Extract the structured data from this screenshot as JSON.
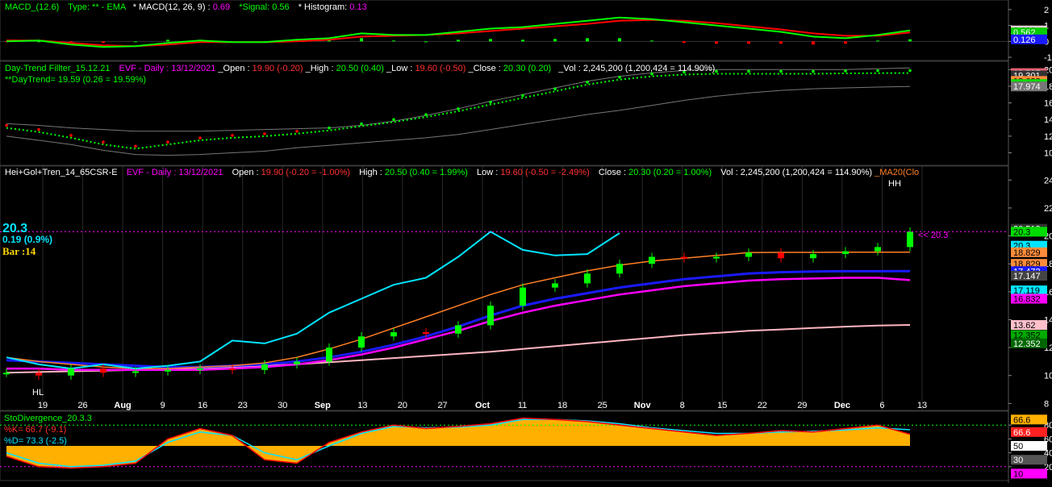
{
  "colors": {
    "bg": "#000000",
    "panel_sep": "#3a3a3a",
    "grid": "#2a2a2a",
    "axis_text": "#ffffff",
    "green": "#00ff00",
    "red": "#ff0000",
    "cyan": "#00e5ff",
    "blue": "#1a1aff",
    "magenta": "#ff00ff",
    "orange": "#ff7f27",
    "pink": "#ffb6c1",
    "grey": "#9a9a9a",
    "yellow": "#ffff00",
    "gold": "#ffd700"
  },
  "macd_panel": {
    "title": "MACD_(12.6)",
    "type_label": "Type: ** - EMA",
    "macd_label": "* MACD(12, 26, 9) : ",
    "macd_value": "0.69",
    "signal_label": "*Signal: ",
    "signal_value": "0.56",
    "hist_label": "* Histogram: ",
    "hist_value": "0.13",
    "axis_ticks": [
      {
        "label": "2",
        "v": 2
      },
      {
        "label": "1",
        "v": 1
      },
      {
        "label": "0",
        "v": 0
      },
      {
        "label": "-1",
        "v": -1
      }
    ],
    "badges": [
      {
        "label": "0.688",
        "v": 0.688,
        "fill": "#ffd0d8",
        "text": "#000000"
      },
      {
        "label": "0.562",
        "v": 0.562,
        "fill": "#00cc00",
        "text": "#ffffff"
      },
      {
        "label": "0.126",
        "v": 0.126,
        "fill": "#1a1aff",
        "text": "#ffffff"
      }
    ]
  },
  "daytrend_panel": {
    "title": "Day-Trend Fillter_15.12.21",
    "evf": "EVF - Daily :  13/12/2021",
    "open_label": "_Open : ",
    "open_value": "19.90 (-0.20)",
    "high_label": "_High : ",
    "high_value": "20.50 (0.40)",
    "low_label": "_Low : ",
    "low_value": "19.60 (-0.50)",
    "close_label": "_Close : ",
    "close_value": "20.30  (0.20)",
    "vol_label": "_Vol : ",
    "vol_value": "2,245,200 (1,200,424 = 114.90%)",
    "line2": "**DayTrend= 19.59 (0.26 = 19.59%)",
    "axis_ticks": [
      {
        "label": "20",
        "v": 20
      },
      {
        "label": "18",
        "v": 18
      },
      {
        "label": "16",
        "v": 16
      },
      {
        "label": "14",
        "v": 14
      },
      {
        "label": "12",
        "v": 12
      },
      {
        "label": "10",
        "v": 10
      }
    ],
    "badges": [
      {
        "label": "19.587",
        "v": 19.587,
        "fill": "#e06070",
        "text": "#ffffff"
      },
      {
        "label": "19.301",
        "v": 19.301,
        "fill": "#333333",
        "text": "#ffffff"
      },
      {
        "label": "18.638",
        "v": 18.638,
        "fill": "#ff8c3a",
        "text": "#000000"
      },
      {
        "label": "18.262",
        "v": 18.262,
        "fill": "#00dd00",
        "text": "#000000"
      },
      {
        "label": "17.974",
        "v": 17.974,
        "fill": "#777777",
        "text": "#ffffff"
      }
    ]
  },
  "price_panel": {
    "title": "Hei+Gol+Tren_14_65CSR-E",
    "evf": "EVF - Daily :  13/12/2021",
    "open_label": "Open : ",
    "open_value": "19.90 (-0.20 = -1.00%)",
    "high_label": "High : ",
    "high_value": "20.50 (0.40 = 1.99%)",
    "low_label": "Low : ",
    "low_value": "19.60 (-0.50 = -2.49%)",
    "close_label": "Close : ",
    "close_value": "20.30  (0.20 = 1.00%)",
    "vol_label": "Vol : ",
    "vol_value": "2,245,200 (1,200,424 = 114.90%)",
    "ma_label": "_MA20(Clo",
    "big_price": "20.3",
    "change": "0.19 (0.9%)",
    "bar": "Bar :14",
    "last_marker": "<< 20.3",
    "hh": "HH",
    "hl": "HL",
    "axis_ticks": [
      {
        "label": "24",
        "v": 24
      },
      {
        "label": "22",
        "v": 22
      },
      {
        "label": "20",
        "v": 20
      },
      {
        "label": "18",
        "v": 18
      },
      {
        "label": "16",
        "v": 16
      },
      {
        "label": "14",
        "v": 14
      },
      {
        "label": "12",
        "v": 12
      },
      {
        "label": "10",
        "v": 10
      },
      {
        "label": "8",
        "v": 8
      }
    ],
    "badges": [
      {
        "label": "20.512",
        "v": 20.512,
        "fill": "#333333",
        "text": "#ffffff"
      },
      {
        "label": "20.3",
        "v": 20.3,
        "fill": "#00dd00",
        "text": "#000000"
      },
      {
        "label": "20.3",
        "v": 19.3,
        "fill": "#00e5ff",
        "text": "#000000"
      },
      {
        "label": "18.829",
        "v": 18.829,
        "fill": "#ff8c3a",
        "text": "#000000"
      },
      {
        "label": "18.829",
        "v": 18.0,
        "fill": "#ff8c3a",
        "text": "#000000"
      },
      {
        "label": "17.472",
        "v": 17.472,
        "fill": "#1a1aff",
        "text": "#ffffff"
      },
      {
        "label": "17.147",
        "v": 17.147,
        "fill": "#444444",
        "text": "#ffffff"
      },
      {
        "label": "17.119",
        "v": 16.1,
        "fill": "#00e5ff",
        "text": "#000000"
      },
      {
        "label": "16.832",
        "v": 15.5,
        "fill": "#ff00ff",
        "text": "#000000"
      },
      {
        "label": "13.62",
        "v": 13.62,
        "fill": "#ffc0cb",
        "text": "#000000"
      },
      {
        "label": "12.352",
        "v": 12.9,
        "fill": "#00aa00",
        "text": "#000000"
      },
      {
        "label": "12.352",
        "v": 12.3,
        "fill": "#006600",
        "text": "#ffffff"
      }
    ]
  },
  "x_axis": [
    {
      "label": "19",
      "bold": false
    },
    {
      "label": "26",
      "bold": false
    },
    {
      "label": "Aug",
      "bold": true
    },
    {
      "label": "9",
      "bold": false
    },
    {
      "label": "16",
      "bold": false
    },
    {
      "label": "23",
      "bold": false
    },
    {
      "label": "30",
      "bold": false
    },
    {
      "label": "Sep",
      "bold": true
    },
    {
      "label": "13",
      "bold": false
    },
    {
      "label": "20",
      "bold": false
    },
    {
      "label": "27",
      "bold": false
    },
    {
      "label": "Oct",
      "bold": true
    },
    {
      "label": "11",
      "bold": false
    },
    {
      "label": "18",
      "bold": false
    },
    {
      "label": "25",
      "bold": false
    },
    {
      "label": "Nov",
      "bold": true
    },
    {
      "label": "8",
      "bold": false
    },
    {
      "label": "15",
      "bold": false
    },
    {
      "label": "22",
      "bold": false
    },
    {
      "label": "29",
      "bold": false
    },
    {
      "label": "Dec",
      "bold": true
    },
    {
      "label": "6",
      "bold": false
    },
    {
      "label": "13",
      "bold": false
    }
  ],
  "sto_panel": {
    "title": "StoDivergence_20.3.3",
    "k_label": "%K= 66.7 (-9.1)",
    "d_label": "%D= 73.3 (-2.5)",
    "axis_ticks": [
      {
        "label": "80",
        "v": 80
      },
      {
        "label": "60",
        "v": 60
      },
      {
        "label": "40",
        "v": 40
      },
      {
        "label": "20",
        "v": 20
      }
    ],
    "badges": [
      {
        "label": "66.6",
        "v": 88,
        "fill": "#ffb000",
        "text": "#000000"
      },
      {
        "label": "66.6",
        "v": 70,
        "fill": "#ff2020",
        "text": "#ffffff"
      },
      {
        "label": "50",
        "v": 50,
        "fill": "#ffffff",
        "text": "#000000"
      },
      {
        "label": "30",
        "v": 30,
        "fill": "#555555",
        "text": "#ffffff"
      },
      {
        "label": "10",
        "v": 10,
        "fill": "#ff00ff",
        "text": "#000000"
      }
    ]
  },
  "chart_data": [
    {
      "type": "line",
      "title": "MACD_(12.6)",
      "ylim": [
        -1.2,
        2.6
      ],
      "dates": [
        "2021-07-19",
        "2021-12-13"
      ],
      "series": [
        {
          "name": "MACD",
          "values": [
            0.0,
            0.05,
            -0.2,
            -0.35,
            -0.3,
            -0.1,
            0.05,
            -0.05,
            -0.05,
            0.1,
            0.2,
            0.5,
            0.4,
            0.4,
            0.6,
            0.8,
            0.9,
            1.1,
            1.3,
            1.5,
            1.4,
            1.2,
            1.0,
            0.8,
            0.6,
            0.3,
            0.2,
            0.4,
            0.69
          ]
        },
        {
          "name": "Signal",
          "values": [
            0.05,
            0.05,
            -0.1,
            -0.25,
            -0.3,
            -0.2,
            -0.05,
            -0.05,
            -0.05,
            0.0,
            0.1,
            0.3,
            0.35,
            0.4,
            0.5,
            0.65,
            0.8,
            0.95,
            1.1,
            1.3,
            1.35,
            1.3,
            1.15,
            0.95,
            0.75,
            0.5,
            0.35,
            0.35,
            0.56
          ]
        },
        {
          "name": "Histogram",
          "values": [
            -0.05,
            0.0,
            -0.1,
            -0.1,
            0.0,
            0.1,
            0.1,
            0.0,
            0.0,
            0.1,
            0.1,
            0.2,
            0.05,
            0.0,
            0.1,
            0.15,
            0.1,
            0.15,
            0.2,
            0.2,
            0.05,
            -0.1,
            -0.15,
            -0.15,
            -0.15,
            -0.2,
            -0.15,
            0.05,
            0.13
          ]
        }
      ]
    },
    {
      "type": "line",
      "title": "Day-Trend Fillter_15.12.21",
      "ylim": [
        8.5,
        21
      ],
      "series": [
        {
          "name": "DayTrend",
          "values": [
            13.0,
            12.5,
            11.8,
            11.0,
            10.5,
            11.0,
            11.5,
            11.8,
            12.0,
            12.3,
            12.7,
            13.2,
            13.7,
            14.3,
            15.0,
            15.8,
            16.6,
            17.4,
            18.2,
            18.8,
            19.2,
            19.4,
            19.5,
            19.5,
            19.5,
            19.5,
            19.55,
            19.58,
            19.59
          ]
        },
        {
          "name": "Upper",
          "values": [
            13.5,
            13.3,
            13.0,
            12.8,
            12.6,
            12.6,
            12.6,
            12.7,
            12.8,
            12.9,
            13.0,
            13.3,
            13.8,
            14.5,
            15.3,
            16.2,
            17.0,
            17.8,
            18.6,
            19.2,
            19.6,
            19.9,
            20.0,
            20.0,
            20.0,
            20.0,
            20.0,
            20.1,
            20.2
          ]
        },
        {
          "name": "Lower",
          "values": [
            12.0,
            11.5,
            11.0,
            10.3,
            9.8,
            9.7,
            9.8,
            10.0,
            10.2,
            10.6,
            10.9,
            11.2,
            11.5,
            11.8,
            12.2,
            12.8,
            13.4,
            14.0,
            14.6,
            15.1,
            15.7,
            16.3,
            16.8,
            17.2,
            17.5,
            17.7,
            17.8,
            17.9,
            17.97
          ]
        }
      ]
    },
    {
      "type": "line",
      "title": "Hei+Gol+Tren_14_65CSR-E",
      "ylim": [
        7.5,
        25
      ],
      "series": [
        {
          "name": "Close",
          "values": [
            10.2,
            10.0,
            10.5,
            10.2,
            10.3,
            10.4,
            10.5,
            10.4,
            10.8,
            11.0,
            12.0,
            12.8,
            13.1,
            13.0,
            13.6,
            15.0,
            16.3,
            16.6,
            17.3,
            18.0,
            18.5,
            18.4,
            18.5,
            18.8,
            18.4,
            18.7,
            18.9,
            19.2,
            20.3
          ]
        },
        {
          "name": "Cyan",
          "values": [
            11.3,
            10.8,
            10.5,
            10.8,
            10.5,
            10.7,
            11.0,
            12.5,
            12.3,
            13.0,
            14.5,
            15.5,
            16.5,
            17.0,
            18.5,
            20.3,
            19.0,
            18.6,
            18.7,
            20.2,
            null,
            null,
            null,
            null,
            null,
            null,
            null,
            null,
            null
          ]
        },
        {
          "name": "MA20",
          "values": [
            11.3,
            11.0,
            10.8,
            10.6,
            10.5,
            10.5,
            10.6,
            10.7,
            10.9,
            11.3,
            11.9,
            12.6,
            13.4,
            14.2,
            15.0,
            15.8,
            16.5,
            17.0,
            17.5,
            17.9,
            18.2,
            18.4,
            18.6,
            18.8,
            18.82,
            18.82,
            18.83,
            18.83,
            18.829
          ]
        },
        {
          "name": "Blue",
          "values": [
            11.1,
            11.0,
            10.9,
            10.8,
            10.7,
            10.6,
            10.6,
            10.7,
            10.8,
            11.0,
            11.3,
            11.7,
            12.2,
            12.8,
            13.5,
            14.3,
            15.0,
            15.5,
            15.9,
            16.3,
            16.6,
            16.9,
            17.1,
            17.3,
            17.4,
            17.45,
            17.47,
            17.47,
            17.472
          ]
        },
        {
          "name": "Magenta",
          "values": [
            10.5,
            10.5,
            10.4,
            10.4,
            10.4,
            10.4,
            10.4,
            10.5,
            10.6,
            10.8,
            11.1,
            11.5,
            12.0,
            12.6,
            13.2,
            13.9,
            14.5,
            15.0,
            15.4,
            15.8,
            16.1,
            16.4,
            16.6,
            16.8,
            16.9,
            16.95,
            17.0,
            17.0,
            16.832
          ]
        },
        {
          "name": "Pink",
          "values": [
            10.2,
            10.25,
            10.3,
            10.35,
            10.4,
            10.45,
            10.5,
            10.6,
            10.7,
            10.8,
            10.95,
            11.1,
            11.25,
            11.4,
            11.55,
            11.7,
            11.9,
            12.1,
            12.3,
            12.5,
            12.7,
            12.9,
            13.05,
            13.2,
            13.3,
            13.4,
            13.5,
            13.58,
            13.62
          ]
        }
      ]
    },
    {
      "type": "area",
      "title": "StoDivergence_20.3.3",
      "ylim": [
        0,
        100
      ],
      "series": [
        {
          "name": "%K",
          "values": [
            35,
            20,
            18,
            20,
            25,
            60,
            75,
            65,
            30,
            25,
            55,
            70,
            80,
            75,
            78,
            82,
            90,
            88,
            85,
            80,
            75,
            70,
            65,
            68,
            72,
            70,
            75,
            80,
            66.7
          ]
        },
        {
          "name": "%D",
          "values": [
            40,
            25,
            20,
            22,
            28,
            55,
            70,
            65,
            40,
            30,
            50,
            68,
            78,
            76,
            77,
            80,
            88,
            88,
            86,
            82,
            76,
            72,
            68,
            68,
            70,
            71,
            73,
            76,
            73.3
          ]
        }
      ]
    }
  ]
}
